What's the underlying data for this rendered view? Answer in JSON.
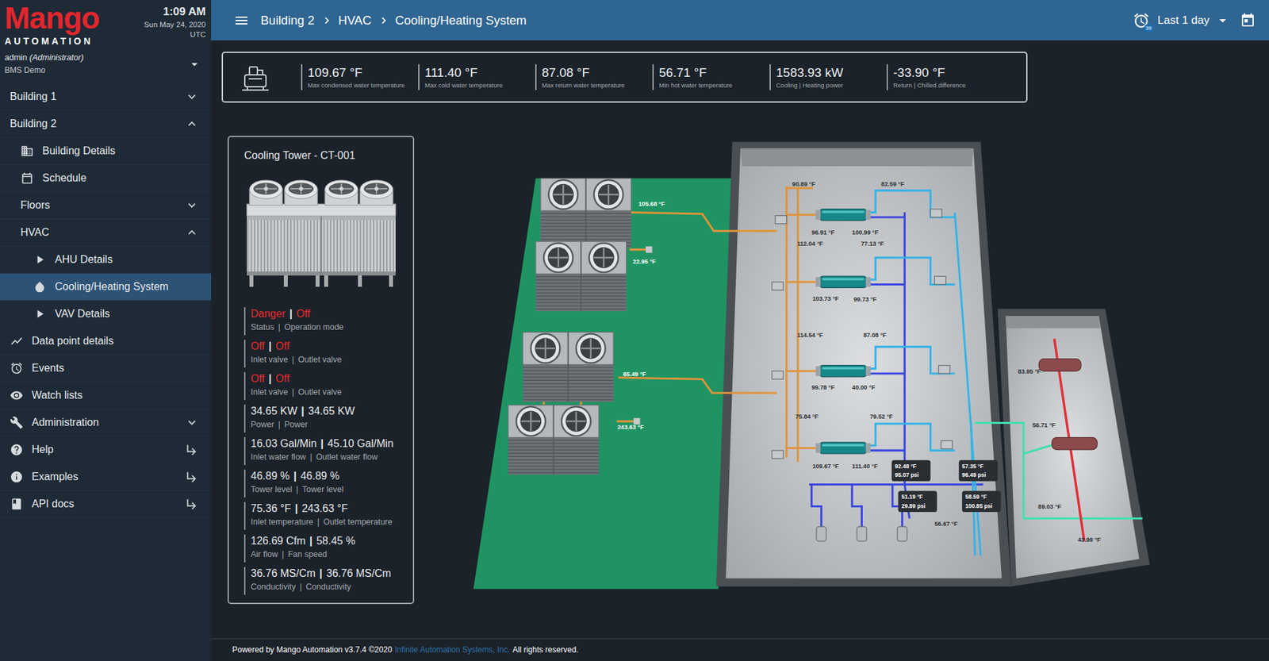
{
  "sidebar": {
    "logo": {
      "brand": "Mango",
      "tagline": "AUTOMATION"
    },
    "clock": {
      "time": "1:09 AM",
      "date": "Sun May 24, 2020",
      "zone": "UTC"
    },
    "user": {
      "name": "admin",
      "role": "(Administrator)",
      "site": "BMS Demo"
    },
    "items": [
      {
        "label": "Building 1",
        "selected": false,
        "external": false,
        "expanded": false
      },
      {
        "label": "Building 2",
        "selected": false,
        "external": false,
        "expanded": true,
        "children": [
          {
            "label": "Building Details",
            "selected": false,
            "external": false
          },
          {
            "label": "Schedule",
            "selected": false,
            "external": false
          },
          {
            "label": "Floors",
            "selected": false,
            "external": false,
            "expanded": false
          },
          {
            "label": "HVAC",
            "selected": false,
            "external": false,
            "expanded": true,
            "children": [
              {
                "label": "AHU Details",
                "selected": false,
                "external": false
              },
              {
                "label": "Cooling/Heating System",
                "selected": true,
                "external": false
              },
              {
                "label": "VAV Details",
                "selected": false,
                "external": false
              }
            ]
          }
        ]
      },
      {
        "label": "Data point details",
        "selected": false,
        "external": false
      },
      {
        "label": "Events",
        "selected": false,
        "external": false
      },
      {
        "label": "Watch lists",
        "selected": false,
        "external": false
      },
      {
        "label": "Administration",
        "selected": false,
        "external": false,
        "expanded": false
      },
      {
        "label": "Help",
        "selected": false,
        "external": true
      },
      {
        "label": "Examples",
        "selected": false,
        "external": true
      },
      {
        "label": "API docs",
        "selected": false,
        "external": true
      }
    ]
  },
  "topbar": {
    "breadcrumb": [
      "Building 2",
      "HVAC",
      "Cooling/Heating System"
    ],
    "alarm_count": "39",
    "range": "Last 1 day"
  },
  "summary": [
    {
      "value": "109.67 °F",
      "label": "Max condensed water temperature"
    },
    {
      "value": "111.40 °F",
      "label": "Max cold water temperature"
    },
    {
      "value": "87.08 °F",
      "label": "Max return water temperature"
    },
    {
      "value": "56.71 °F",
      "label": "Min hot water temperature"
    },
    {
      "value": "1583.93 kW",
      "label": "Cooling | Heating power"
    },
    {
      "value": "-33.90 °F",
      "label": "Return | Chilled difference"
    }
  ],
  "tower_card": {
    "title": "Cooling Tower - CT-001",
    "separator": "|",
    "rows": [
      {
        "values": [
          "Danger",
          "Off"
        ],
        "labels": [
          "Status",
          "Operation mode"
        ],
        "alert": true
      },
      {
        "values": [
          "Off",
          "Off"
        ],
        "labels": [
          "Inlet valve",
          "Outlet valve"
        ],
        "alert": true
      },
      {
        "values": [
          "Off",
          "Off"
        ],
        "labels": [
          "Inlet valve",
          "Outlet valve"
        ],
        "alert": true
      },
      {
        "values": [
          "34.65 KW",
          "34.65 KW"
        ],
        "labels": [
          "Power",
          "Power"
        ],
        "alert": false
      },
      {
        "values": [
          "16.03 Gal/Min",
          "45.10 Gal/Min"
        ],
        "labels": [
          "Inlet water flow",
          "Outlet water flow"
        ],
        "alert": false
      },
      {
        "values": [
          "46.89 %",
          "46.89 %"
        ],
        "labels": [
          "Tower level",
          "Tower level"
        ],
        "alert": false
      },
      {
        "values": [
          "75.36 °F",
          "243.63 °F"
        ],
        "labels": [
          "Inlet temperature",
          "Outlet temperature"
        ],
        "alert": false
      },
      {
        "values": [
          "126.69 Cfm",
          "58.45 %"
        ],
        "labels": [
          "Air flow",
          "Fan speed"
        ],
        "alert": false
      },
      {
        "values": [
          "36.76 MS/Cm",
          "36.76 MS/Cm"
        ],
        "labels": [
          "Conductivity",
          "Conductivity"
        ],
        "alert": false
      }
    ]
  },
  "plant": {
    "labels": [
      "105.68 °F",
      "22.95 °F",
      "65.49 °F",
      "243.63 °F",
      "90.89 °F",
      "82.59 °F",
      "96.91 °F",
      "100.99 °F",
      "112.04 °F",
      "77.13 °F",
      "103.73 °F",
      "99.73 °F",
      "114.54 °F",
      "87.08 °F",
      "99.78 °F",
      "40.00 °F",
      "75.84 °F",
      "79.52 °F",
      "109.67 °F",
      "111.40 °F",
      "56.67 °F",
      "83.95 °F",
      "56.71 °F",
      "89.03 °F",
      "43.99 °F"
    ],
    "readouts": [
      {
        "temperature": "92.48 °F",
        "pressure": "95.07 psi"
      },
      {
        "temperature": "57.35 °F",
        "pressure": "96.49 psi"
      },
      {
        "temperature": "51.19 °F",
        "pressure": "29.89 psi"
      },
      {
        "temperature": "58.59 °F",
        "pressure": "100.85 psi"
      }
    ]
  },
  "footer": {
    "prefix": "Powered by Mango Automation v3.7.4 ©2020",
    "link": "Infinite Automation Systems, Inc.",
    "suffix": "All rights reserved."
  }
}
